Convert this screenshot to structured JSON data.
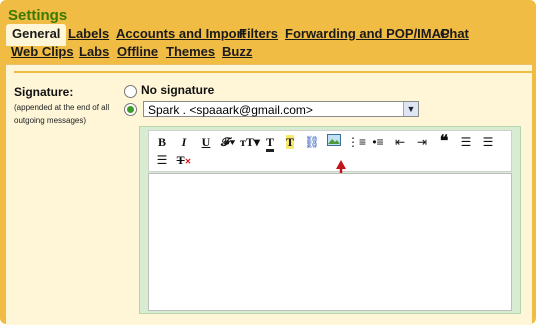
{
  "title": "Settings",
  "tabs_row1": [
    "General",
    "Labels",
    "Accounts and Import",
    "Filters",
    "Forwarding and POP/IMAP",
    "Chat"
  ],
  "tabs_row2": [
    "Web Clips",
    "Labs",
    "Offline",
    "Themes",
    "Buzz"
  ],
  "signature": {
    "label": "Signature:",
    "note": "(appended at the end of all outgoing messages)",
    "no_signature_label": "No signature",
    "selected_value": "Spark . <spaaark@gmail.com>"
  },
  "colors": {
    "frame": "#f1bc43",
    "title": "#3a7a00",
    "panel": "#fff6d8",
    "editor_border": "#d7ecd0",
    "arrow": "#c0141a"
  },
  "toolbar_icons": [
    "bold-icon",
    "italic-icon",
    "underline-icon",
    "font-icon",
    "font-size-icon",
    "text-color-icon",
    "highlight-icon",
    "link-icon",
    "insert-image-icon",
    "numbered-list-icon",
    "bulleted-list-icon",
    "outdent-icon",
    "indent-icon",
    "quote-icon",
    "align-left-icon",
    "align-center-icon",
    "align-right-icon",
    "remove-formatting-icon"
  ]
}
